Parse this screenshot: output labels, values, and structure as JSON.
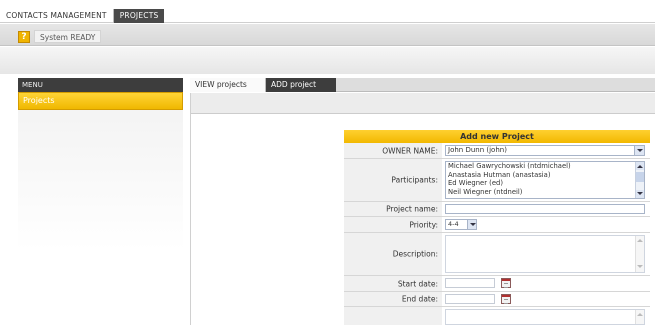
{
  "topnav": {
    "tabs": [
      {
        "label": "CONTACTS MANAGEMENT"
      },
      {
        "label": "PROJECTS"
      }
    ]
  },
  "status": {
    "icon": "help-icon",
    "icon_glyph": "?",
    "text": "System READY"
  },
  "sidebar": {
    "header": "MENU",
    "items": [
      {
        "label": "Projects"
      }
    ]
  },
  "subtabs": [
    {
      "label": "VIEW projects"
    },
    {
      "label": "ADD project"
    }
  ],
  "form": {
    "title": "Add new Project",
    "owner_label": "OWNER NAME:",
    "owner_value": "John Dunn (john)",
    "participants_label": "Participants:",
    "participants": [
      "Michael Gawrychowski (ntdmichael)",
      "Anastasia Hutman (anastasia)",
      "Ed Wiegner (ed)",
      "Neil Wiegner (ntdneil)"
    ],
    "project_name_label": "Project name:",
    "project_name_value": "",
    "priority_label": "Priority:",
    "priority_value": "4-4",
    "description_label": "Description:",
    "start_label": "Start date:",
    "end_label": "End date:"
  },
  "colors": {
    "accent": "#f2b800",
    "dark": "#3d3d3d"
  }
}
